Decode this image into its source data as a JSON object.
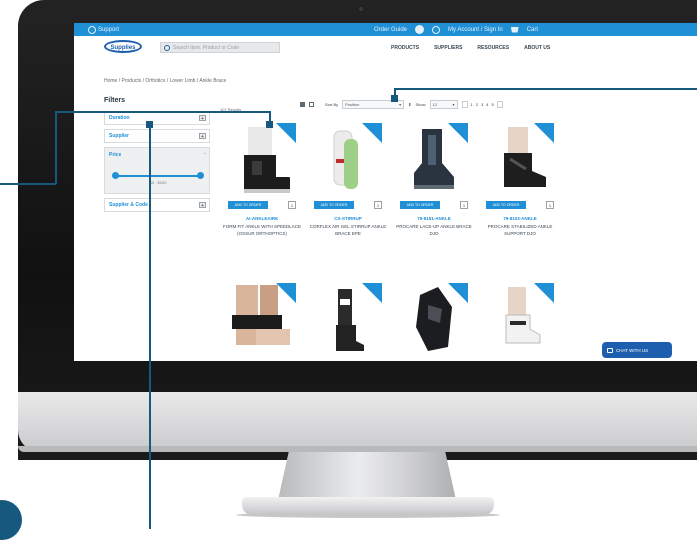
{
  "topbar": {
    "support": "Support",
    "order_tracking": "Order Guide",
    "account": "My Account / Sign In",
    "cart": "Cart"
  },
  "header": {
    "logo": "Supplies",
    "search_placeholder": "Search Item, Product or Code",
    "nav": [
      "PRODUCTS",
      "SUPPLIERS",
      "RESOURCES",
      "ABOUT US"
    ]
  },
  "breadcrumb": "Home  /  Products  /  Orthotics  /  Lower Limb  /  Ankle Brace",
  "filters": {
    "title": "Filters",
    "items": [
      {
        "label": "Duration",
        "control": "+"
      },
      {
        "label": "Supplier",
        "control": "+"
      }
    ],
    "price": {
      "label": "Price",
      "control": "-",
      "range": "$0 - $100"
    },
    "supplier_code": {
      "label": "Supplier & Code",
      "control": "+"
    }
  },
  "results": {
    "count": "107 Results",
    "sort_label": "Sort By",
    "sort_value": "Position",
    "show_label": "Show",
    "show_value": "12",
    "pages": [
      "1",
      "2",
      "3",
      "4",
      "5"
    ]
  },
  "products": [
    {
      "sku": "AI-ANKLEAIRE",
      "title": "FORM FIT ANKLE WITH SPEEDLACE (OSSUR ORTHOPTICS)",
      "add": "ADD TO ORDER",
      "qty": "1"
    },
    {
      "sku": "CS-STIRRUP",
      "title": "CORFLEX AIR GEL STIRRUP ANKLE BRACE EPE",
      "add": "ADD TO ORDER",
      "qty": "1"
    },
    {
      "sku": "79-8151-ANKLE",
      "title": "PROCARE LACE-UP ANKLE BRACE DJO",
      "add": "ADD TO ORDER",
      "qty": "1"
    },
    {
      "sku": "79-8103-ANKLE",
      "title": "PROCARE STABILIZED ANKLE SUPPORT DJO",
      "add": "ADD TO ORDER",
      "qty": "1"
    }
  ],
  "chat": {
    "label": "CHAT WITH US"
  },
  "colors": {
    "brand": "#1f8fd6",
    "logo": "#1d5fae",
    "callout": "#17587e"
  }
}
